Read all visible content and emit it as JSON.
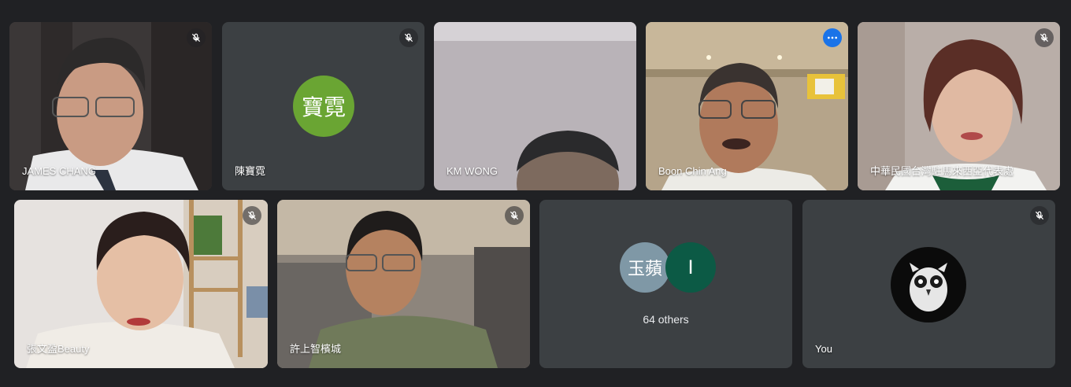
{
  "participants": [
    {
      "name": "JAMES CHANG",
      "muted": true
    },
    {
      "name": "陳寶霓",
      "avatar_text": "寶霓",
      "avatar_color": "#6aa533",
      "muted": true
    },
    {
      "name": "KM WONG",
      "muted": false
    },
    {
      "name": "Boon Chin Ang",
      "muted": false,
      "active_speaker": true
    },
    {
      "name": "中華民國台灣駐馬來西亞代表處",
      "muted": true
    },
    {
      "name": "張文盈Beauty",
      "muted": true
    },
    {
      "name": "許上智檳城",
      "muted": true
    }
  ],
  "others": {
    "avatars": [
      {
        "text": "玉蘋",
        "color": "#7f98a6"
      },
      {
        "text": "I",
        "color": "#0c5a45"
      }
    ],
    "label": "64 others"
  },
  "self": {
    "name": "You",
    "muted": true
  },
  "colors": {
    "background": "#202124",
    "tile": "#3c4043",
    "accent": "#8ab4f8"
  }
}
